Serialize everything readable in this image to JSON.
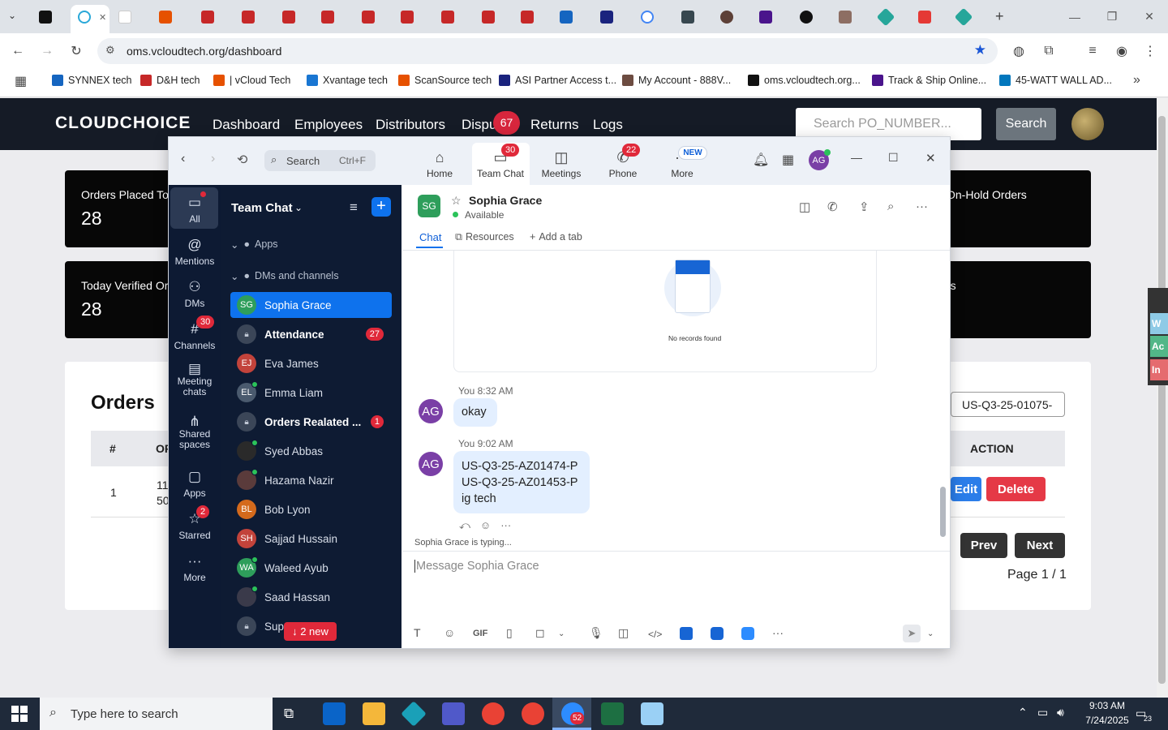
{
  "browser": {
    "url": "oms.vcloudtech.org/dashboard",
    "bookmarks": [
      {
        "label": "SYNNEX tech",
        "color": "#1565c0"
      },
      {
        "label": "D&H tech",
        "color": "#c62828"
      },
      {
        "label": "| vCloud Tech",
        "color": "#e65100"
      },
      {
        "label": "Xvantage tech",
        "color": "#1976d2"
      },
      {
        "label": "ScanSource tech",
        "color": "#e65100"
      },
      {
        "label": "ASI Partner Access t...",
        "color": "#1a237e"
      },
      {
        "label": "My Account - 888V...",
        "color": "#6d4c41"
      },
      {
        "label": "oms.vcloudtech.org...",
        "color": "#111111"
      },
      {
        "label": "Track & Ship Online...",
        "color": "#4a148c"
      },
      {
        "label": "45-WATT WALL AD...",
        "color": "#0277bd"
      }
    ]
  },
  "site": {
    "logo": "CLOUDCHOICE",
    "nav": [
      "Dashboard",
      "Employees",
      "Distributors",
      "Dispu",
      "Returns",
      "Logs"
    ],
    "disputes_badge": "67",
    "search_placeholder": "Search PO_NUMBER...",
    "search_button": "Search",
    "cards": [
      {
        "title": "Orders Placed Toc",
        "value": "28"
      },
      {
        "title": "Today Verified Or",
        "value": "28"
      },
      {
        "title": "On-Hold Orders",
        "value": ""
      },
      {
        "title": "rs",
        "value": ""
      }
    ],
    "orders": {
      "title": "Orders",
      "search_value": "US-Q3-25-01075-",
      "col_hash": "#",
      "col_or": "OF",
      "col_action": "ACTION",
      "row_num": "1",
      "row_val1": "11",
      "row_val2": "50",
      "edit": "Edit",
      "delete": "Delete",
      "prev": "Prev",
      "next": "Next",
      "page": "Page 1 / 1"
    },
    "side_tabs": [
      "W",
      "Ac",
      "In"
    ]
  },
  "zoom": {
    "search_label": "Search",
    "search_shortcut": "Ctrl+F",
    "topnav": {
      "home": "Home",
      "team_chat": "Team Chat",
      "team_chat_badge": "30",
      "meetings": "Meetings",
      "phone": "Phone",
      "phone_badge": "22",
      "more": "More",
      "more_badge": "NEW"
    },
    "user_initials": "AG",
    "rail": {
      "all": "All",
      "mentions": "Mentions",
      "dms": "DMs",
      "channels": "Channels",
      "channels_badge": "30",
      "meeting_chats": "Meeting chats",
      "shared_spaces": "Shared spaces",
      "apps": "Apps",
      "starred": "Starred",
      "starred_badge": "2",
      "more": "More"
    },
    "list_title": "Team Chat",
    "section_apps": "Apps",
    "section_dms": "DMs and channels",
    "contacts": [
      {
        "initials": "SG",
        "name": "Sophia Grace",
        "color": "#2e9e5b",
        "bold": false,
        "badge": "",
        "online": false,
        "lock": false,
        "selected": true
      },
      {
        "initials": "",
        "name": "Attendance",
        "color": "#3b4658",
        "bold": true,
        "badge": "27",
        "online": false,
        "lock": true,
        "selected": false
      },
      {
        "initials": "EJ",
        "name": "Eva James",
        "color": "#c2433b",
        "bold": false,
        "badge": "",
        "online": false,
        "lock": false,
        "selected": false
      },
      {
        "initials": "EL",
        "name": "Emma Liam",
        "color": "#4a5a6e",
        "bold": false,
        "badge": "",
        "online": true,
        "lock": false,
        "selected": false
      },
      {
        "initials": "",
        "name": "Orders Realated ...",
        "color": "#3b4658",
        "bold": true,
        "badge": "1",
        "online": false,
        "lock": true,
        "selected": false
      },
      {
        "initials": "",
        "name": "Syed Abbas",
        "color": "#2a2a2a",
        "bold": false,
        "badge": "",
        "online": true,
        "lock": false,
        "selected": false
      },
      {
        "initials": "",
        "name": "Hazama Nazir",
        "color": "#5a3b3b",
        "bold": false,
        "badge": "",
        "online": true,
        "lock": false,
        "selected": false
      },
      {
        "initials": "BL",
        "name": "Bob Lyon",
        "color": "#d46a1c",
        "bold": false,
        "badge": "",
        "online": false,
        "lock": false,
        "selected": false
      },
      {
        "initials": "SH",
        "name": "Sajjad Hussain",
        "color": "#c2433b",
        "bold": false,
        "badge": "",
        "online": false,
        "lock": false,
        "selected": false
      },
      {
        "initials": "WA",
        "name": "Waleed Ayub",
        "color": "#2e9e5b",
        "bold": false,
        "badge": "",
        "online": true,
        "lock": false,
        "selected": false
      },
      {
        "initials": "",
        "name": "Saad Hassan",
        "color": "#3a3a4a",
        "bold": false,
        "badge": "",
        "online": true,
        "lock": false,
        "selected": false
      },
      {
        "initials": "",
        "name": "Sup",
        "color": "#3b4658",
        "bold": false,
        "badge": "",
        "online": false,
        "lock": true,
        "selected": false
      }
    ],
    "new_messages": "2 new",
    "chat": {
      "initials": "SG",
      "name": "Sophia Grace",
      "status": "Available",
      "tab_chat": "Chat",
      "tab_resources": "Resources",
      "tab_add": "Add a tab",
      "no_records": "No records found",
      "msg1_meta": "You 8:32 AM",
      "msg1_text": "okay",
      "msg2_meta": "You 9:02 AM",
      "msg2_line1": "US-Q3-25-AZ01474-P",
      "msg2_line2": "US-Q3-25-AZ01453-P",
      "msg2_line3": "ig tech",
      "typing": "Sophia Grace  is typing...",
      "compose_placeholder": "Message Sophia Grace",
      "gif": "GIF"
    }
  },
  "taskbar": {
    "search_placeholder": "Type here to search",
    "time": "9:03 AM",
    "date": "7/24/2025",
    "zoom_badge": "52",
    "notif_count": "23"
  }
}
